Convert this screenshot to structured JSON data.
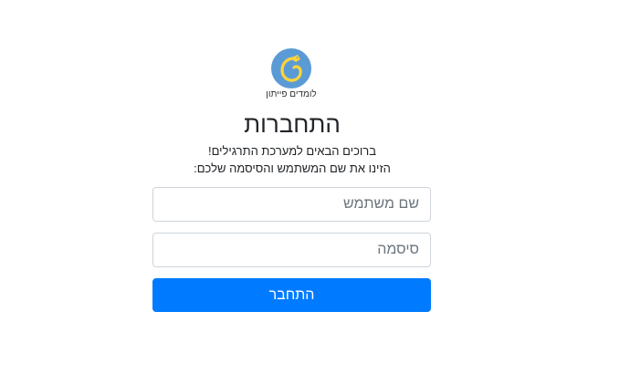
{
  "logo": {
    "icon": "snake-logo-icon",
    "caption": "לומדים פייתון",
    "circle_color": "#5b9bd5",
    "snake_color": "#ffd43b"
  },
  "login": {
    "title": "התחברות",
    "welcome_line1": "ברוכים הבאים למערכת התרגילים!",
    "welcome_line2": "הזינו את שם המשתמש והסיסמה שלכם:",
    "username_placeholder": "שם משתמש",
    "username_value": "",
    "password_placeholder": "סיסמה",
    "password_value": "",
    "submit_label": "התחבר"
  },
  "colors": {
    "primary": "#007bff",
    "border": "#ced4da",
    "text": "#212529"
  }
}
